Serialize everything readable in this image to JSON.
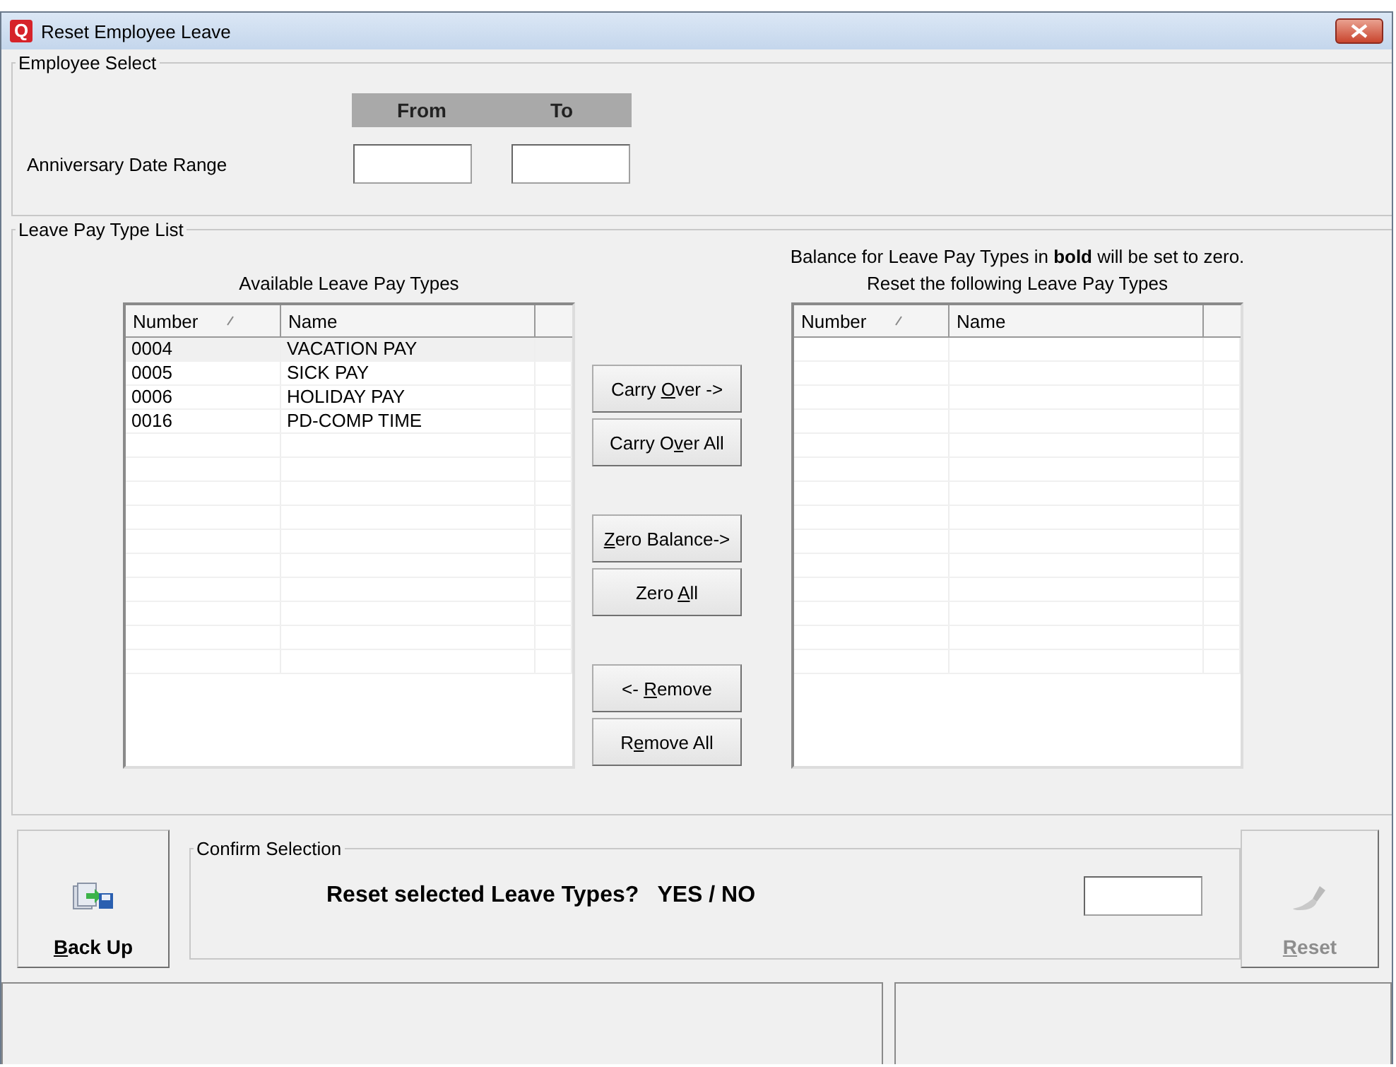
{
  "window": {
    "logo": "Q",
    "title": "Reset Employee Leave"
  },
  "employee_select": {
    "legend": "Employee Select",
    "range_label": "Anniversary Date Range",
    "columns": [
      "From",
      "To"
    ]
  },
  "leave_pay_type_list": {
    "legend": "Leave Pay Type List",
    "available": {
      "caption": "Available Leave Pay Types",
      "columns": [
        {
          "label": "Number",
          "sorted": true
        },
        {
          "label": "Name",
          "sorted": false
        }
      ],
      "rows": [
        {
          "number": "0004",
          "name": "VACATION PAY",
          "selected": true
        },
        {
          "number": "0005",
          "name": "SICK PAY",
          "selected": false
        },
        {
          "number": "0006",
          "name": "HOLIDAY PAY",
          "selected": false
        },
        {
          "number": "0016",
          "name": "PD-COMP TIME",
          "selected": false
        }
      ]
    },
    "note": "Balance for Leave Pay Types in **bold** will be set to zero.",
    "reset": {
      "caption": "Reset the following Leave Pay Types",
      "columns": [
        {
          "label": "Number",
          "sorted": true
        },
        {
          "label": "Name",
          "sorted": false
        }
      ]
    },
    "button_groups": [
      [
        {
          "pre": "Carry ",
          "key": "O",
          "post": "ver ->"
        },
        {
          "pre": "Carry O",
          "key": "v",
          "post": "er All"
        }
      ],
      [
        {
          "key": "Z",
          "post": "ero Balance->"
        },
        {
          "pre": "Zero ",
          "key": "A",
          "post": "ll"
        }
      ],
      [
        {
          "pre": "<- ",
          "key": "R",
          "post": "emove"
        },
        {
          "pre": "R",
          "key": "e",
          "post": "move All"
        }
      ]
    ]
  },
  "back_up": {
    "key": "B",
    "post": "ack Up",
    "disabled": false
  },
  "confirm": {
    "legend": "Confirm Selection",
    "question": "Reset selected Leave Types?   YES / NO"
  },
  "reset_button": {
    "key": "R",
    "post": "eset",
    "disabled": true
  }
}
